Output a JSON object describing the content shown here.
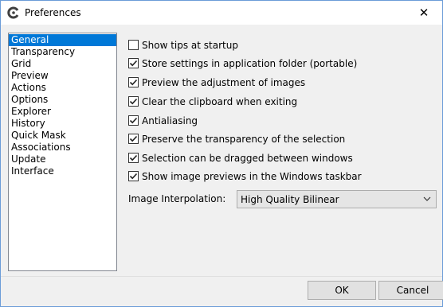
{
  "window": {
    "title": "Preferences",
    "close_glyph": "✕"
  },
  "sidebar": {
    "items": [
      {
        "label": "General",
        "selected": true
      },
      {
        "label": "Transparency",
        "selected": false
      },
      {
        "label": "Grid",
        "selected": false
      },
      {
        "label": "Preview",
        "selected": false
      },
      {
        "label": "Actions",
        "selected": false
      },
      {
        "label": "Options",
        "selected": false
      },
      {
        "label": "Explorer",
        "selected": false
      },
      {
        "label": "History",
        "selected": false
      },
      {
        "label": "Quick Mask",
        "selected": false
      },
      {
        "label": "Associations",
        "selected": false
      },
      {
        "label": "Update",
        "selected": false
      },
      {
        "label": "Interface",
        "selected": false
      }
    ]
  },
  "options": [
    {
      "label": "Show tips at startup",
      "checked": false
    },
    {
      "label": "Store settings in application folder (portable)",
      "checked": true
    },
    {
      "label": "Preview the adjustment of images",
      "checked": true
    },
    {
      "label": "Clear the clipboard when exiting",
      "checked": true
    },
    {
      "label": "Antialiasing",
      "checked": true
    },
    {
      "label": "Preserve the transparency of the selection",
      "checked": true
    },
    {
      "label": "Selection can be dragged between windows",
      "checked": true
    },
    {
      "label": "Show image previews in the Windows taskbar",
      "checked": true
    }
  ],
  "interpolation": {
    "label": "Image Interpolation:",
    "value": "High Quality Bilinear"
  },
  "buttons": {
    "ok": "OK",
    "cancel": "Cancel"
  },
  "colors": {
    "selection": "#0078d7",
    "window_border": "#6b9cd8"
  }
}
